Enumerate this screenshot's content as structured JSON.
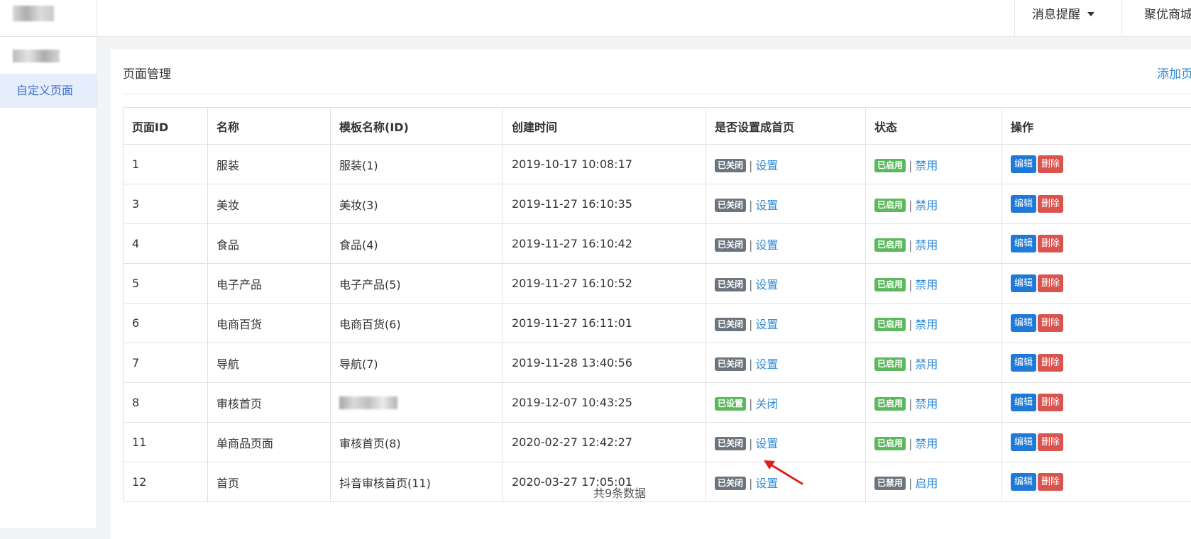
{
  "sidebar": {
    "active_item": "自定义页面"
  },
  "topbar": {
    "notifications_label": "消息提醒",
    "shop_label": "聚优商城"
  },
  "panel": {
    "title": "页面管理",
    "add_label": "添加页",
    "footer_count": "共9条数据"
  },
  "table": {
    "headers": [
      "页面ID",
      "名称",
      "模板名称(ID)",
      "创建时间",
      "是否设置成首页",
      "状态",
      "操作"
    ],
    "rows": [
      {
        "id": "1",
        "name": "服装",
        "template": "服装(1)",
        "created": "2019-10-17 10:08:17",
        "home_badge": "已关闭",
        "home_action": "设置",
        "status_badge": "已启用",
        "status_action": "禁用",
        "edit": "编辑",
        "delete": "删除"
      },
      {
        "id": "3",
        "name": "美妆",
        "template": "美妆(3)",
        "created": "2019-11-27 16:10:35",
        "home_badge": "已关闭",
        "home_action": "设置",
        "status_badge": "已启用",
        "status_action": "禁用",
        "edit": "编辑",
        "delete": "删除"
      },
      {
        "id": "4",
        "name": "食品",
        "template": "食品(4)",
        "created": "2019-11-27 16:10:42",
        "home_badge": "已关闭",
        "home_action": "设置",
        "status_badge": "已启用",
        "status_action": "禁用",
        "edit": "编辑",
        "delete": "删除"
      },
      {
        "id": "5",
        "name": "电子产品",
        "template": "电子产品(5)",
        "created": "2019-11-27 16:10:52",
        "home_badge": "已关闭",
        "home_action": "设置",
        "status_badge": "已启用",
        "status_action": "禁用",
        "edit": "编辑",
        "delete": "删除"
      },
      {
        "id": "6",
        "name": "电商百货",
        "template": "电商百货(6)",
        "created": "2019-11-27 16:11:01",
        "home_badge": "已关闭",
        "home_action": "设置",
        "status_badge": "已启用",
        "status_action": "禁用",
        "edit": "编辑",
        "delete": "删除"
      },
      {
        "id": "7",
        "name": "导航",
        "template": "导航(7)",
        "created": "2019-11-28 13:40:56",
        "home_badge": "已关闭",
        "home_action": "设置",
        "status_badge": "已启用",
        "status_action": "禁用",
        "edit": "编辑",
        "delete": "删除"
      },
      {
        "id": "8",
        "name": "审核首页",
        "template": "",
        "created": "2019-12-07 10:43:25",
        "home_badge": "已设置",
        "home_action": "关闭",
        "status_badge": "已启用",
        "status_action": "禁用",
        "edit": "编辑",
        "delete": "删除"
      },
      {
        "id": "11",
        "name": "单商品页面",
        "template": "审核首页(8)",
        "created": "2020-02-27 12:42:27",
        "home_badge": "已关闭",
        "home_action": "设置",
        "status_badge": "已启用",
        "status_action": "禁用",
        "edit": "编辑",
        "delete": "删除"
      },
      {
        "id": "12",
        "name": "首页",
        "template": "抖音审核首页(11)",
        "created": "2020-03-27 17:05:01",
        "home_badge": "已关闭",
        "home_action": "设置",
        "status_badge": "已禁用",
        "status_action": "启用",
        "edit": "编辑",
        "delete": "删除"
      }
    ]
  },
  "colors": {
    "link": "#2d8ad6",
    "badge_gray": "#6c757d",
    "badge_green": "#5cb85c",
    "edit_button": "#1e7ad6",
    "delete_button": "#d9534f",
    "annotation_arrow": "#e0201c"
  }
}
